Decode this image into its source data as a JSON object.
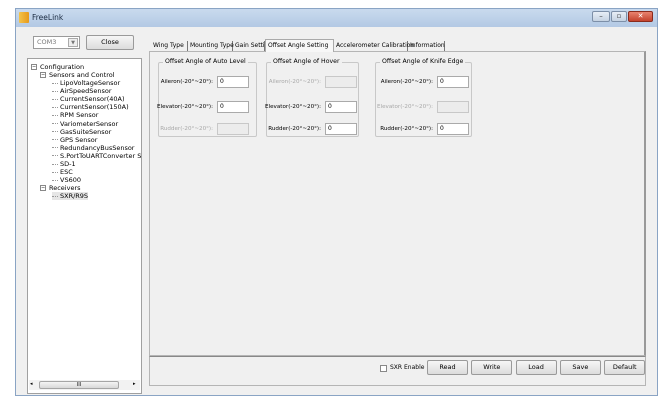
{
  "window": {
    "title": "FreeLink",
    "controls": [
      "minimize",
      "maximize",
      "close"
    ]
  },
  "left": {
    "port_combo": "COM3",
    "close_button": "Close"
  },
  "tree": {
    "root": "Configuration",
    "sensors_group": "Sensors and Control",
    "sensors": [
      "LipoVoltageSensor",
      "AirSpeedSensor",
      "CurrentSensor(40A)",
      "CurrentSensor(150A)",
      "RPM Sensor",
      "VariometerSensor",
      "GasSuiteSensor",
      "GPS Sensor",
      "RedundancyBusSensor",
      "S.PortToUARTConverter S",
      "SD-1",
      "ESC",
      "VS600"
    ],
    "receivers_group": "Receivers",
    "receivers": [
      "SXR/R9S"
    ],
    "scroll_thumb": "III"
  },
  "tabs": [
    "Wing Type",
    "Mounting Type",
    "Gain Setting",
    "Offset Angle Setting",
    "Accelerometer Calibration",
    "Information"
  ],
  "active_tab": "Offset Angle Setting",
  "groups": [
    {
      "title": "Offset Angle of Auto Level",
      "rows": [
        {
          "label": "Aileron(-20°~20°):",
          "value": "0",
          "enabled": true
        },
        {
          "label": "Elevator(-20°~20°):",
          "value": "0",
          "enabled": true
        },
        {
          "label": "Rudder(-20°~20°):",
          "value": "",
          "enabled": false
        }
      ]
    },
    {
      "title": "Offset Angle of Hover",
      "rows": [
        {
          "label": "Aileron(-20°~20°):",
          "value": "",
          "enabled": false
        },
        {
          "label": "Elevator(-20°~20°):",
          "value": "0",
          "enabled": true
        },
        {
          "label": "Rudder(-20°~20°):",
          "value": "0",
          "enabled": true
        }
      ]
    },
    {
      "title": "Offset Angle of Knife Edge",
      "rows": [
        {
          "label": "Aileron(-20°~20°):",
          "value": "0",
          "enabled": true
        },
        {
          "label": "Elevator(-20°~20°):",
          "value": "",
          "enabled": false
        },
        {
          "label": "Rudder(-20°~20°):",
          "value": "0",
          "enabled": true
        }
      ]
    }
  ],
  "bottom": {
    "sxr_enable_label": "SXR Enable",
    "sxr_enable_checked": false,
    "buttons": [
      "Read",
      "Write",
      "Load",
      "Save",
      "Default"
    ]
  }
}
